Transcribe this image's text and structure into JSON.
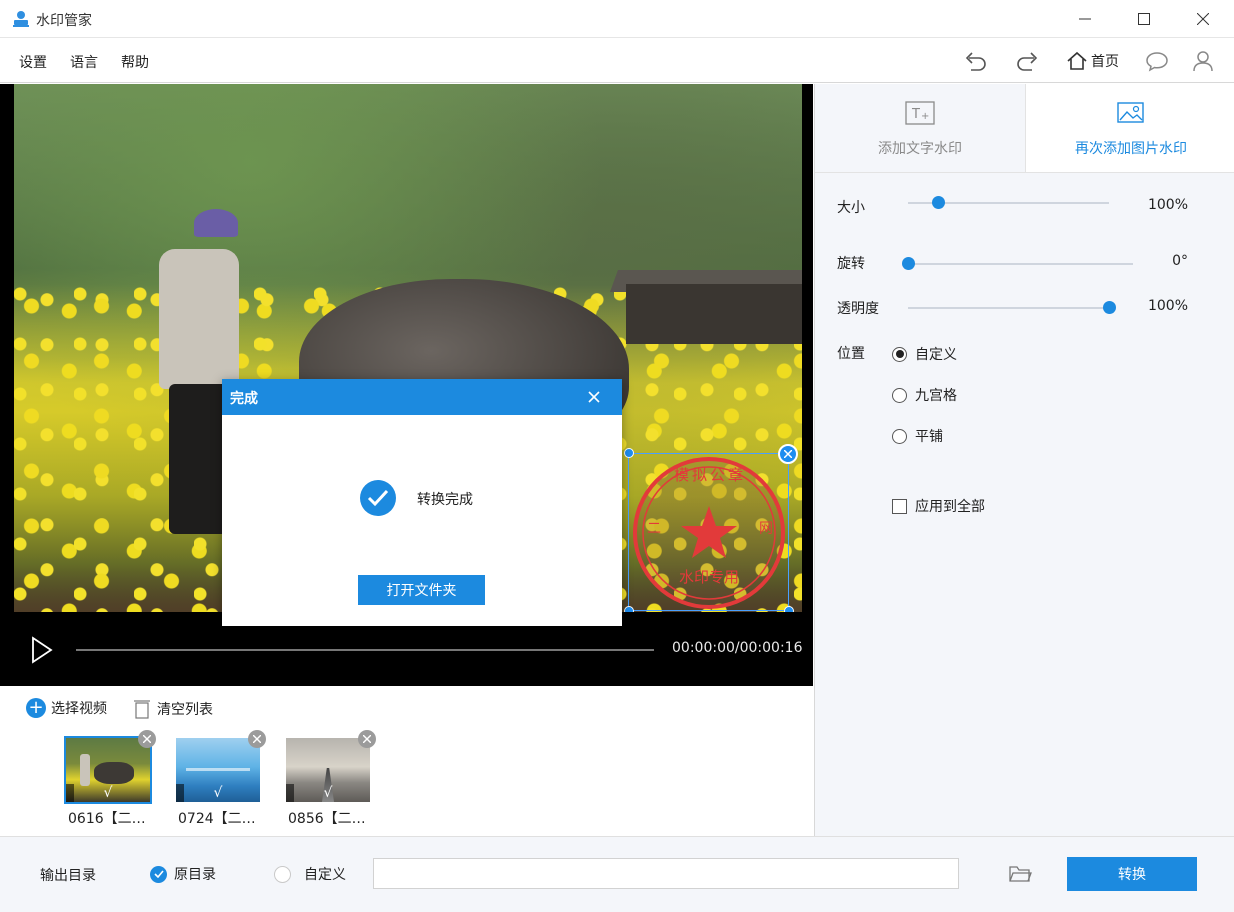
{
  "app": {
    "title": "水印管家"
  },
  "menu": {
    "items": [
      "设置",
      "语言",
      "帮助"
    ]
  },
  "toolbar": {
    "home_label": "首页"
  },
  "player": {
    "timecode": "00:00:00/00:00:16"
  },
  "watermark": {
    "stamp_top_text": "模拟公章",
    "stamp_side_left": "二",
    "stamp_side_right": "网",
    "stamp_bottom_text": "水印专用"
  },
  "dialog": {
    "title": "完成",
    "message": "转换完成",
    "button_label": "打开文件夹"
  },
  "file_list": {
    "add_label": "选择视频",
    "clear_label": "清空列表",
    "check_mark": "√",
    "items": [
      {
        "label": "0616【二…",
        "selected": true
      },
      {
        "label": "0724【二…",
        "selected": false
      },
      {
        "label": "0856【二…",
        "selected": false
      }
    ]
  },
  "panel": {
    "tabs": [
      {
        "label": "添加文字水印",
        "active": false
      },
      {
        "label": "再次添加图片水印",
        "active": true
      }
    ],
    "size": {
      "label": "大小",
      "value": "100%",
      "level": 0.15
    },
    "rotate": {
      "label": "旋转",
      "value": "0°",
      "level": 0.0
    },
    "opacity": {
      "label": "透明度",
      "value": "100%",
      "level": 1.0
    },
    "position": {
      "label": "位置",
      "options": [
        {
          "label": "自定义",
          "checked": true
        },
        {
          "label": "九宫格",
          "checked": false
        },
        {
          "label": "平铺",
          "checked": false
        }
      ]
    },
    "apply_all": {
      "label": "应用到全部",
      "checked": false
    }
  },
  "output": {
    "label": "输出目录",
    "options": [
      {
        "label": "原目录",
        "checked": true
      },
      {
        "label": "自定义",
        "checked": false
      }
    ],
    "path_value": "",
    "convert_label": "转换"
  },
  "colors": {
    "accent": "#1c8adf",
    "stamp_red": "#e23a3a"
  }
}
